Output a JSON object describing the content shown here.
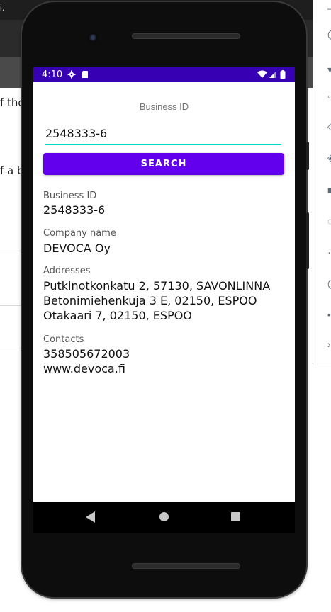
{
  "background": {
    "title_fragment": "i.",
    "text_fragment_1": "f the",
    "text_fragment_2": "f a b"
  },
  "statusbar": {
    "time": "4:10"
  },
  "search": {
    "label": "Business ID",
    "value": "2548333-6",
    "button_label": "SEARCH"
  },
  "result": {
    "business_id_label": "Business ID",
    "business_id_value": "2548333-6",
    "company_name_label": "Company name",
    "company_name_value": "DEVOCA Oy",
    "addresses_label": "Addresses",
    "addresses": [
      "Putkinotkonkatu 2, 57130, SAVONLINNA",
      "Betonimiehenkuja 3 E, 02150, ESPOO",
      "Otakaari 7, 02150, ESPOO"
    ],
    "contacts_label": "Contacts",
    "contacts": [
      "358505672003",
      "www.devoca.fi"
    ]
  },
  "colors": {
    "statusbar": "#3700b3",
    "primary": "#6200ee",
    "accent": "#03dac5"
  },
  "icons": {
    "status": [
      "settings-icon",
      "sd-card-icon",
      "wifi-icon",
      "signal-icon",
      "battery-icon"
    ],
    "navigation": [
      "back-icon",
      "home-icon",
      "recent-apps-icon"
    ]
  }
}
